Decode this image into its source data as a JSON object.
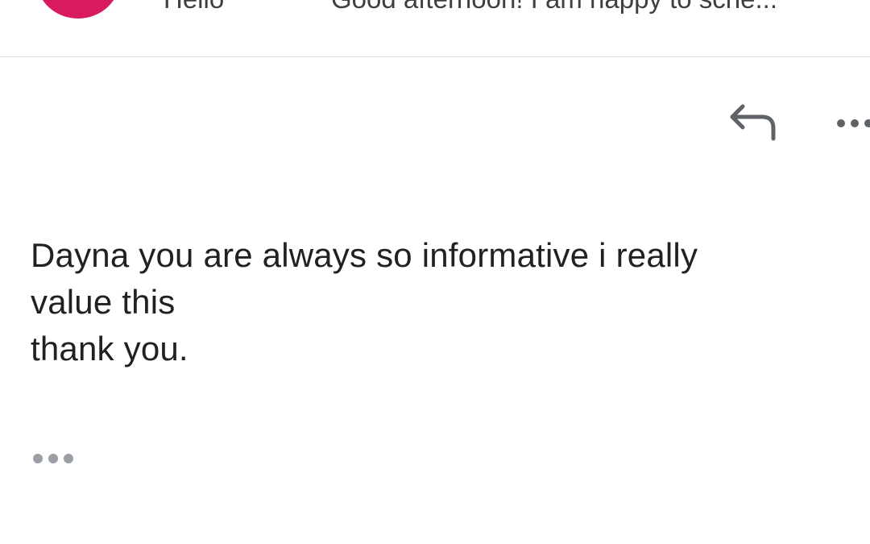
{
  "previous_message": {
    "sender": "Hello",
    "snippet": "Good afternoon! I am happy to sche...",
    "avatar_color": "#d81b60"
  },
  "actions": {
    "reply_icon": "reply-icon",
    "more_icon": "more-options-icon"
  },
  "message": {
    "body_lines": [
      "Dayna you are always so informative i really",
      "value this",
      "thank you."
    ],
    "quoted_toggle_icon": "show-trimmed-content-icon"
  },
  "colors": {
    "text_primary": "#202124",
    "icon_gray": "#5f6368",
    "dots_gray": "#9aa0a6",
    "divider": "#dadce0"
  }
}
